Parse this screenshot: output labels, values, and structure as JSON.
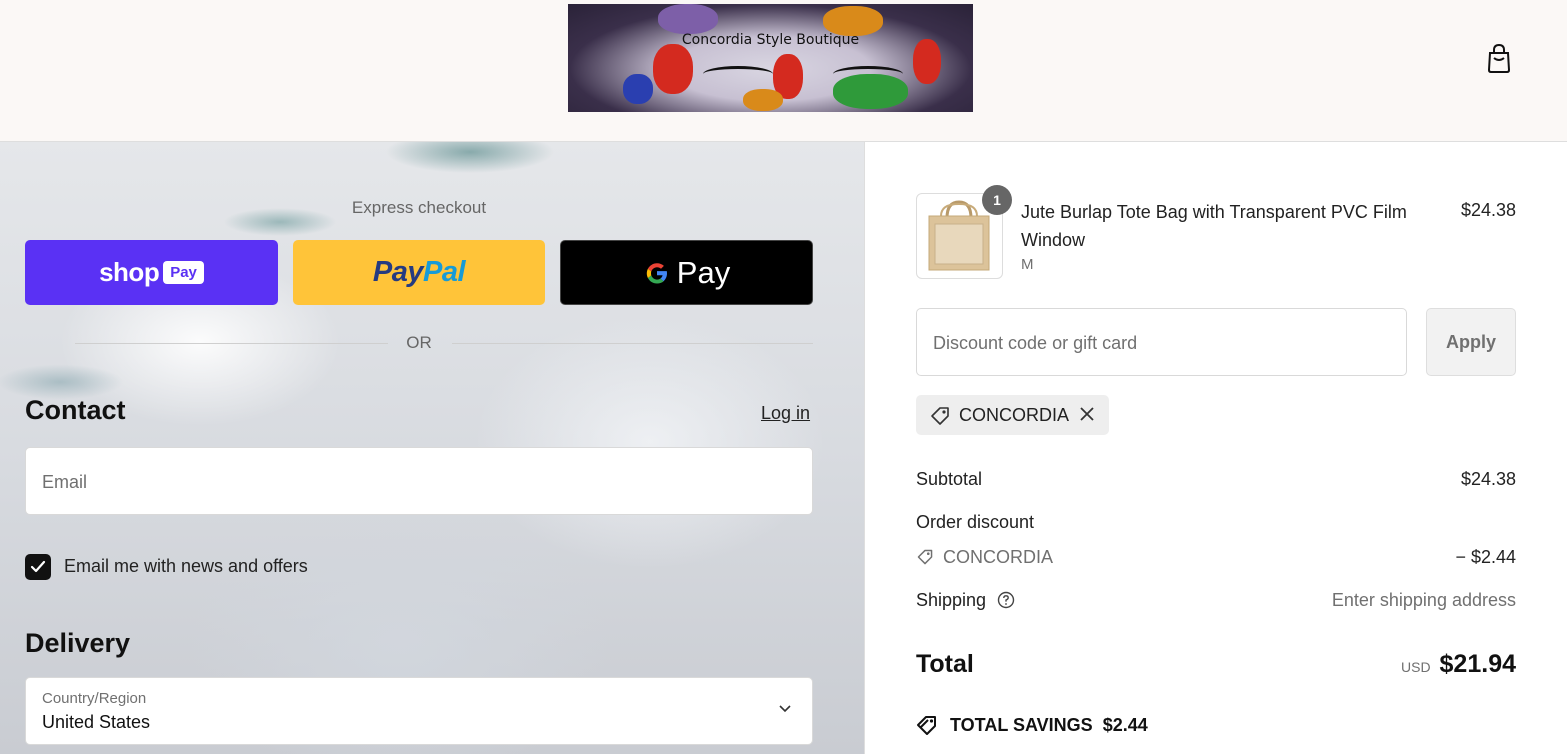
{
  "header": {
    "store_name": "Concordia Style Boutique",
    "cart_icon": "shopping-bag-icon"
  },
  "express": {
    "label": "Express checkout",
    "shop_pay": {
      "word": "shop",
      "badge": "Pay"
    },
    "paypal": {
      "part1": "Pay",
      "part2": "Pal"
    },
    "gpay": {
      "letter": "G",
      "word": "Pay"
    },
    "or": "OR"
  },
  "contact": {
    "title": "Contact",
    "login": "Log in",
    "email_placeholder": "Email",
    "newsletter_label": "Email me with news and offers",
    "newsletter_checked": true
  },
  "delivery": {
    "title": "Delivery",
    "country_label": "Country/Region",
    "country_value": "United States"
  },
  "summary": {
    "item": {
      "quantity": "1",
      "name": "Jute Burlap Tote Bag with Transparent PVC Film Window",
      "variant": "M",
      "price": "$24.38"
    },
    "discount": {
      "placeholder": "Discount code or gift card",
      "apply": "Apply",
      "applied_code": "CONCORDIA"
    },
    "subtotal_label": "Subtotal",
    "subtotal": "$24.38",
    "order_discount_label": "Order discount",
    "discount_code": "CONCORDIA",
    "discount_amount": "− $2.44",
    "shipping_label": "Shipping",
    "shipping_value": "Enter shipping address",
    "total_label": "Total",
    "currency": "USD",
    "total": "$21.94",
    "savings_label": "TOTAL SAVINGS",
    "savings": "$2.44"
  },
  "colors": {
    "shop_pay": "#5a31f4",
    "paypal": "#ffc439",
    "gpay": "#000000"
  }
}
